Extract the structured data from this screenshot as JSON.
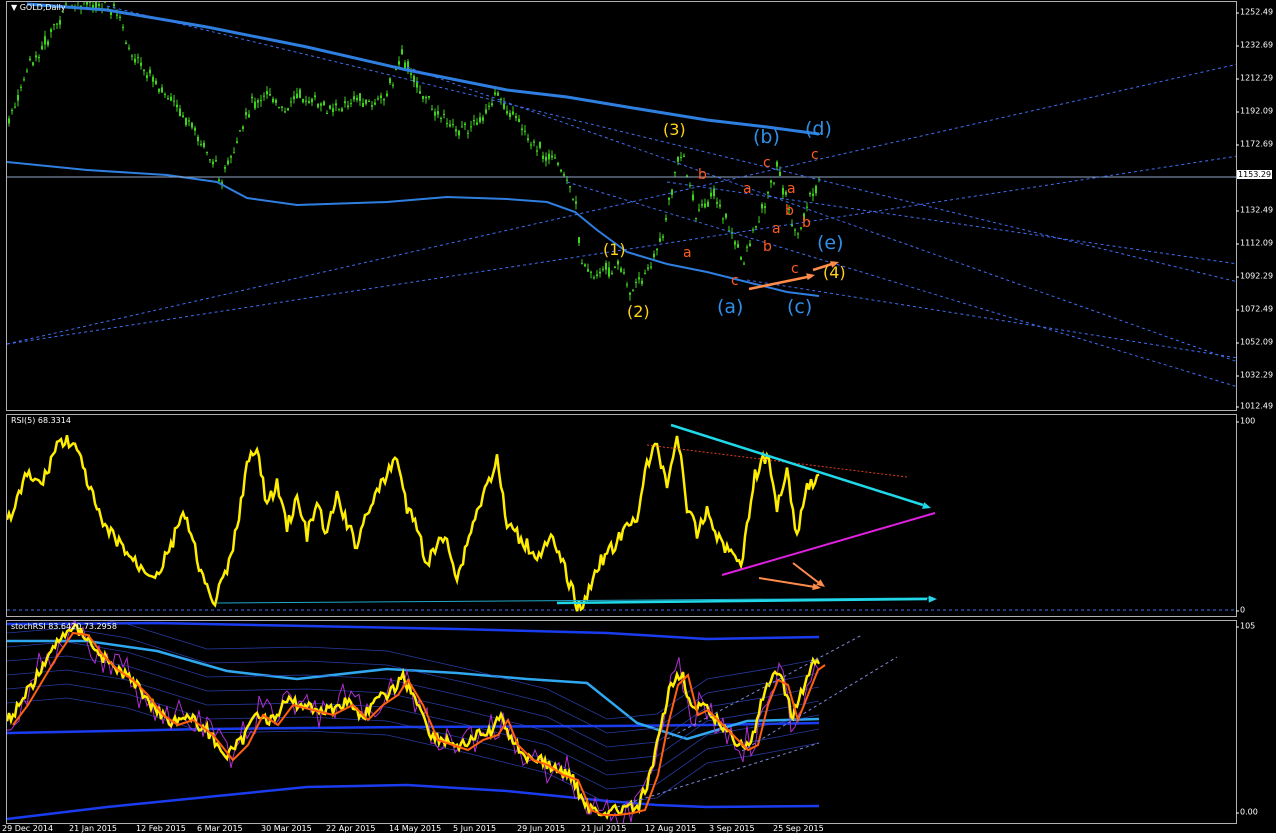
{
  "chart": {
    "symbol_label": "GOLD,Daily",
    "current_price": "1153.29",
    "price_ticks": [
      "1252.49",
      "1232.69",
      "1212.29",
      "1192.09",
      "1172.69",
      "1132.49",
      "1112.09",
      "1092.29",
      "1072.49",
      "1052.09",
      "1032.29",
      "1012.49"
    ],
    "date_ticks": [
      "29 Dec 2014",
      "21 Jan 2015",
      "12 Feb 2015",
      "6 Mar 2015",
      "30 Mar 2015",
      "22 Apr 2015",
      "14 May 2015",
      "5 Jun 2015",
      "29 Jun 2015",
      "21 Jul 2015",
      "12 Aug 2015",
      "3 Sep 2015",
      "25 Sep 2015"
    ]
  },
  "rsi": {
    "label": "RSI(5) 68.3314",
    "axis_top": "100",
    "axis_bottom": "0"
  },
  "stoch": {
    "label": "stochRSI 83.6420 73.2958",
    "axis_top": "105",
    "axis_bottom": "0.00"
  },
  "waves": {
    "yellow": [
      "(1)",
      "(2)",
      "(3)",
      "(4)"
    ],
    "blue": [
      "(a)",
      "(b)",
      "(c)",
      "(d)",
      "(e)"
    ],
    "red": [
      "a",
      "b",
      "c",
      "a",
      "b",
      "c",
      "a",
      "b",
      "c",
      "a",
      "b",
      "c"
    ]
  },
  "colors": {
    "candles": "#3ed41e",
    "blue_ma": "#2f7fe0",
    "rsi_line": "#ffee00",
    "cyan_line": "#20d8e8",
    "magenta_line": "#e020e0",
    "arrows": "#ff8c4a",
    "wave_yellow": "#ffd21a",
    "wave_blue": "#2f8fe8",
    "wave_red": "#ff5a1e"
  }
}
